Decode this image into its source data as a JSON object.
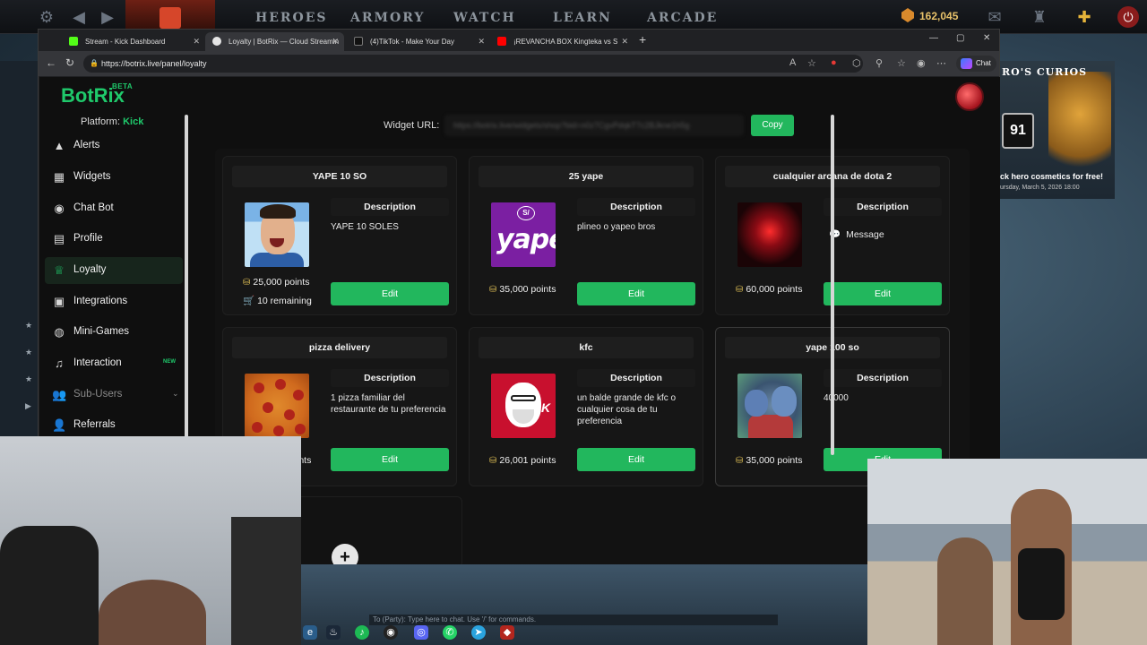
{
  "game": {
    "nav": [
      "HEROES",
      "ARMORY",
      "WATCH",
      "LEARN",
      "ARCADE"
    ],
    "shards": "162,045",
    "curios": {
      "title": "RO'S CURIOS",
      "level": "91",
      "promo": "ck hero cosmetics for free!",
      "date": "ursday, March 5, 2026 18:00"
    }
  },
  "browser": {
    "tabs": [
      {
        "label": "Stream - Kick Dashboard",
        "color": "#53fc18"
      },
      {
        "label": "Loyalty | BotRix — Cloud Streamin",
        "color": "#e6e6e6"
      },
      {
        "label": "(4)TikTok - Make Your Day",
        "color": "#111111"
      },
      {
        "label": "¡REVANCHA BOX Kingteka vs S",
        "color": "#ff0000"
      }
    ],
    "url": "https://botrix.live/panel/loyalty",
    "chat_label": "Chat"
  },
  "app": {
    "logo": "BotRix",
    "beta": "BETA",
    "platform_label": "Platform:",
    "platform_value": "Kick",
    "sidebar": [
      {
        "label": "Alerts",
        "icon": "alert-icon"
      },
      {
        "label": "Widgets",
        "icon": "widgets-icon"
      },
      {
        "label": "Chat Bot",
        "icon": "chat-bot-icon"
      },
      {
        "label": "Profile",
        "icon": "profile-icon"
      },
      {
        "label": "Loyalty",
        "icon": "trophy-icon"
      },
      {
        "label": "Integrations",
        "icon": "integrations-icon"
      },
      {
        "label": "Mini-Games",
        "icon": "gamepad-icon"
      },
      {
        "label": "Interaction",
        "icon": "music-icon",
        "badge": "NEW"
      },
      {
        "label": "Sub-Users",
        "icon": "users-icon"
      },
      {
        "label": "Referrals",
        "icon": "referrals-icon"
      }
    ],
    "widget_url_label": "Widget URL:",
    "widget_url_value": "https://botrix.live/widgets/shop?bid=n0z7CgvPdqkT7c2BJkne1h5g",
    "copy_label": "Copy",
    "accent": "#22b75d"
  },
  "rewards": [
    {
      "title": "YAPE 10 SO",
      "description_label": "Description",
      "description": "YAPE 10 SOLES",
      "points": "25,000 points",
      "remaining": "10 remaining",
      "edit_label": "Edit"
    },
    {
      "title": "25 yape",
      "description_label": "Description",
      "description": "plineo o yapeo bros",
      "points": "35,000 points",
      "edit_label": "Edit"
    },
    {
      "title": "cualquier arcana de dota 2",
      "description_label": "Description",
      "message": "Message",
      "points": "60,000 points",
      "edit_label": "Edit"
    },
    {
      "title": "pizza delivery",
      "description_label": "Description",
      "description": "1 pizza familiar del restaurante de tu preferencia",
      "points": "ints",
      "edit_label": "Edit"
    },
    {
      "title": "kfc",
      "description_label": "Description",
      "description": "un balde grande de kfc o cualquier cosa de tu preferencia",
      "points": "26,001 points",
      "edit_label": "Edit"
    },
    {
      "title": "yape 100 so",
      "description_label": "Description",
      "description": "40000",
      "points": "35,000 points",
      "edit_label": "Edit"
    }
  ],
  "yape_logo": "yape",
  "yape_s": "S/",
  "stream_chat_placeholder": "To (Party): Type here to chat. Use '/' for commands."
}
